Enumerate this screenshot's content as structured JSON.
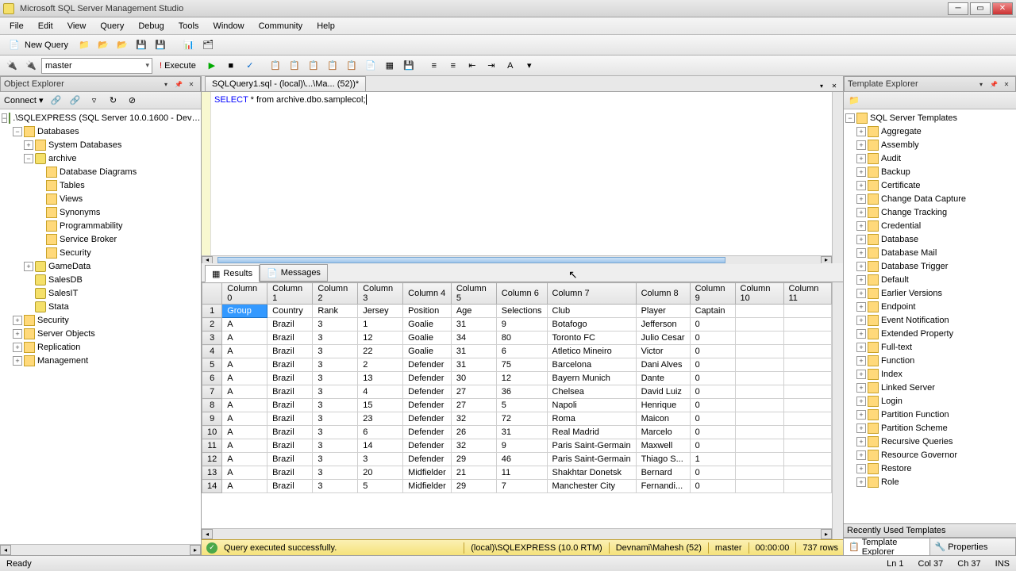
{
  "title": "Microsoft SQL Server Management Studio",
  "menus": [
    "File",
    "Edit",
    "View",
    "Query",
    "Debug",
    "Tools",
    "Window",
    "Community",
    "Help"
  ],
  "new_query": "New Query",
  "db_combo": "master",
  "execute": "Execute",
  "object_explorer": {
    "title": "Object Explorer",
    "connect": "Connect",
    "root": ".\\SQLEXPRESS (SQL Server 10.0.1600 - Dev…",
    "nodes": {
      "databases": "Databases",
      "system_db": "System Databases",
      "archive": "archive",
      "ddiagrams": "Database Diagrams",
      "tables": "Tables",
      "views": "Views",
      "synonyms": "Synonyms",
      "programmability": "Programmability",
      "service_broker": "Service Broker",
      "security_db": "Security",
      "gamedata": "GameData",
      "salesdb": "SalesDB",
      "salesit": "SalesIT",
      "stata": "Stata",
      "security": "Security",
      "server_objects": "Server Objects",
      "replication": "Replication",
      "management": "Management"
    }
  },
  "doc_tab": "SQLQuery1.sql - (local)\\...\\Ma... (52))*",
  "sql_kw": "SELECT",
  "sql_rest": " * from archive.dbo.samplecol;",
  "results_tab": "Results",
  "messages_tab": "Messages",
  "grid": {
    "columns": [
      "Column 0",
      "Column 1",
      "Column 2",
      "Column 3",
      "Column 4",
      "Column 5",
      "Column 6",
      "Column 7",
      "Column 8",
      "Column 9",
      "Column 10",
      "Column 11"
    ],
    "rows": [
      [
        "Group",
        "Country",
        "Rank",
        "Jersey",
        "Position",
        "Age",
        "Selections",
        "Club",
        "Player",
        "Captain",
        "",
        ""
      ],
      [
        "A",
        "Brazil",
        "3",
        "1",
        "Goalie",
        "31",
        "9",
        "Botafogo",
        "Jefferson",
        "0",
        "",
        ""
      ],
      [
        "A",
        "Brazil",
        "3",
        "12",
        "Goalie",
        "34",
        "80",
        "Toronto FC",
        "Julio Cesar",
        "0",
        "",
        ""
      ],
      [
        "A",
        "Brazil",
        "3",
        "22",
        "Goalie",
        "31",
        "6",
        "Atletico Mineiro",
        "Victor",
        "0",
        "",
        ""
      ],
      [
        "A",
        "Brazil",
        "3",
        "2",
        "Defender",
        "31",
        "75",
        "Barcelona",
        "Dani Alves",
        "0",
        "",
        ""
      ],
      [
        "A",
        "Brazil",
        "3",
        "13",
        "Defender",
        "30",
        "12",
        "Bayern Munich",
        "Dante",
        "0",
        "",
        ""
      ],
      [
        "A",
        "Brazil",
        "3",
        "4",
        "Defender",
        "27",
        "36",
        "Chelsea",
        "David Luiz",
        "0",
        "",
        ""
      ],
      [
        "A",
        "Brazil",
        "3",
        "15",
        "Defender",
        "27",
        "5",
        "Napoli",
        "Henrique",
        "0",
        "",
        ""
      ],
      [
        "A",
        "Brazil",
        "3",
        "23",
        "Defender",
        "32",
        "72",
        "Roma",
        "Maicon",
        "0",
        "",
        ""
      ],
      [
        "A",
        "Brazil",
        "3",
        "6",
        "Defender",
        "26",
        "31",
        "Real Madrid",
        "Marcelo",
        "0",
        "",
        ""
      ],
      [
        "A",
        "Brazil",
        "3",
        "14",
        "Defender",
        "32",
        "9",
        "Paris Saint-Germain",
        "Maxwell",
        "0",
        "",
        ""
      ],
      [
        "A",
        "Brazil",
        "3",
        "3",
        "Defender",
        "29",
        "46",
        "Paris Saint-Germain",
        "Thiago S...",
        "1",
        "",
        ""
      ],
      [
        "A",
        "Brazil",
        "3",
        "20",
        "Midfielder",
        "21",
        "11",
        "Shakhtar Donetsk",
        "Bernard",
        "0",
        "",
        ""
      ],
      [
        "A",
        "Brazil",
        "3",
        "5",
        "Midfielder",
        "29",
        "7",
        "Manchester City",
        "Fernandi...",
        "0",
        "",
        ""
      ]
    ]
  },
  "query_status": {
    "msg": "Query executed successfully.",
    "server": "(local)\\SQLEXPRESS (10.0 RTM)",
    "user": "Devnami\\Mahesh (52)",
    "db": "master",
    "time": "00:00:00",
    "rows": "737 rows"
  },
  "template_explorer": {
    "title": "Template Explorer",
    "root": "SQL Server Templates",
    "items": [
      "Aggregate",
      "Assembly",
      "Audit",
      "Backup",
      "Certificate",
      "Change Data Capture",
      "Change Tracking",
      "Credential",
      "Database",
      "Database Mail",
      "Database Trigger",
      "Default",
      "Earlier Versions",
      "Endpoint",
      "Event Notification",
      "Extended Property",
      "Full-text",
      "Function",
      "Index",
      "Linked Server",
      "Login",
      "Partition Function",
      "Partition Scheme",
      "Recursive Queries",
      "Resource Governor",
      "Restore",
      "Role"
    ],
    "recent": "Recently Used Templates",
    "tab_te": "Template Explorer",
    "tab_props": "Properties"
  },
  "statusbar": {
    "ready": "Ready",
    "ln": "Ln 1",
    "col": "Col 37",
    "ch": "Ch 37",
    "ins": "INS"
  }
}
